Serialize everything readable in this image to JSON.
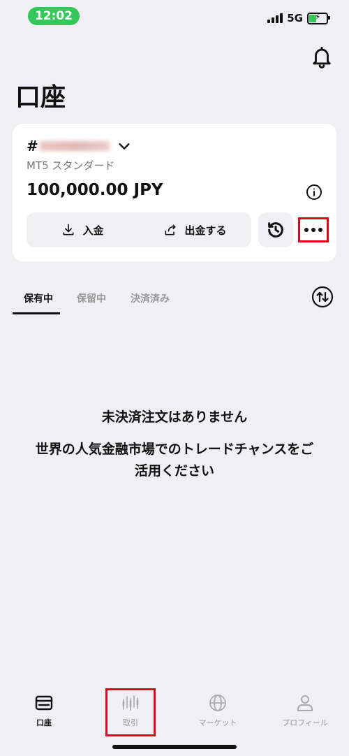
{
  "status_bar": {
    "time": "12:02",
    "network": "5G"
  },
  "header": {
    "title": "口座"
  },
  "account_card": {
    "account_prefix": "#",
    "account_type": "MT5 スタンダード",
    "balance": "100,000.00 JPY",
    "deposit_label": "入金",
    "withdraw_label": "出金する"
  },
  "tabs": [
    {
      "label": "保有中",
      "active": true
    },
    {
      "label": "保留中",
      "active": false
    },
    {
      "label": "決済済み",
      "active": false
    }
  ],
  "empty_state": {
    "title": "未決済注文はありません",
    "message": "世界の人気金融市場でのトレードチャンスをご活用ください"
  },
  "bottom_nav": [
    {
      "label": "口座",
      "icon": "card-icon",
      "active": true
    },
    {
      "label": "取引",
      "icon": "candles-icon",
      "active": false
    },
    {
      "label": "マーケット",
      "icon": "globe-icon",
      "active": false
    },
    {
      "label": "プロフィール",
      "icon": "person-icon",
      "active": false
    }
  ],
  "colors": {
    "accent_green": "#34c759",
    "highlight_red": "#e0061b",
    "background": "#f0eff4"
  }
}
